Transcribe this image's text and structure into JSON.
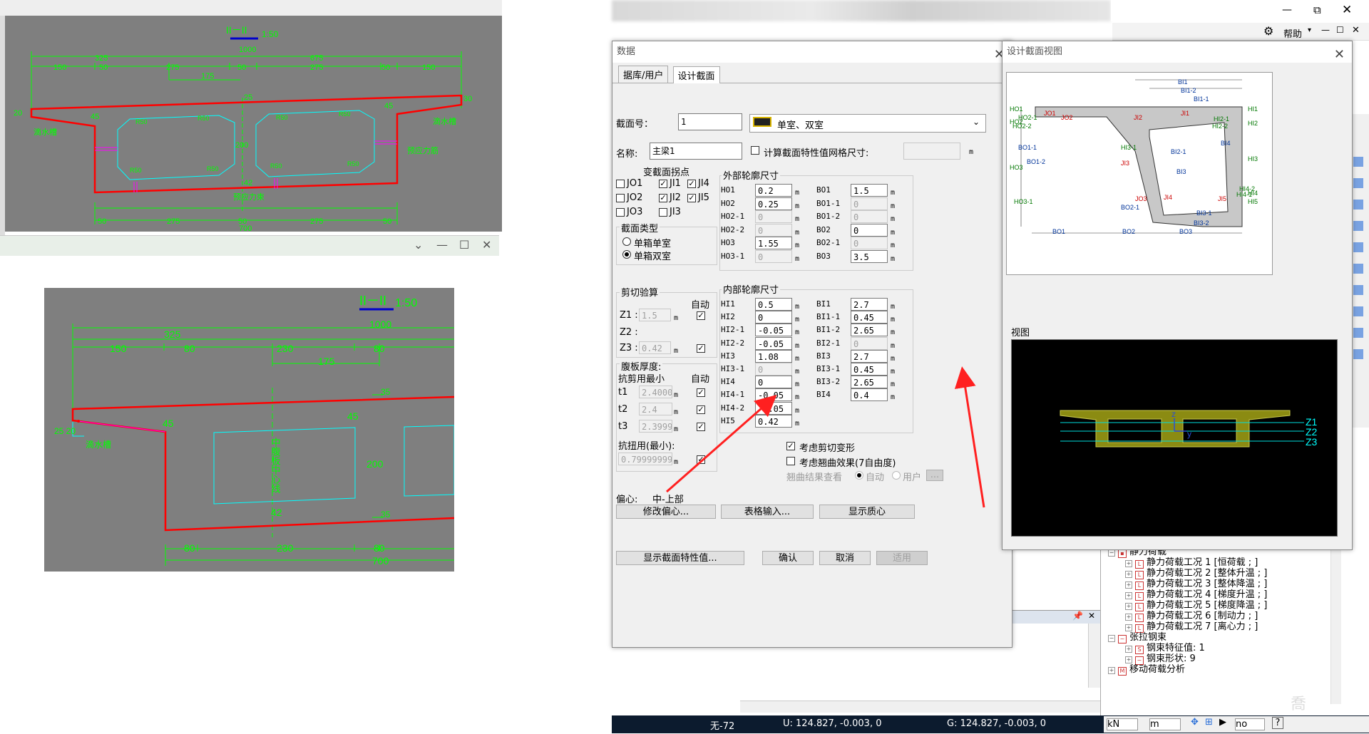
{
  "top_cad": {
    "title": "II－II",
    "scale": "1:50",
    "dims_top": [
      "325",
      "675",
      "1000"
    ],
    "dims_sub": [
      "150",
      "50",
      "275",
      "50",
      "275",
      "50",
      "150"
    ],
    "dim_175": "175",
    "dims_bottom": [
      "50",
      "275",
      "50",
      "275",
      "50",
      "700"
    ],
    "side_left": "20",
    "side_right": "30",
    "web_45_left": "45",
    "web_45_right": "45",
    "center_200": "200",
    "center_25": "25",
    "center_42": "42",
    "label_drip_left": "滴水槽",
    "label_drip_right": "滴水槽",
    "label_tendon": "预应力筋",
    "label_bottom": "预应力束",
    "ducts": [
      "R50",
      "R50",
      "R50",
      "R50",
      "R50",
      "R50",
      "R50",
      "R50"
    ]
  },
  "bottom_window": {
    "controls": [
      "⌄",
      "—",
      "☐",
      "✕"
    ]
  },
  "bottom_cad": {
    "title": "II－II",
    "scale": "1:50",
    "dim_325": "325",
    "dim_1000": "1000",
    "dims_sub": [
      "150",
      "80",
      "230",
      "80"
    ],
    "dim_175": "175",
    "left_dims": "25 20",
    "web_45_left": "45",
    "web_45_right": "45",
    "center_200": "200",
    "top_35": "35",
    "bot_35": "35",
    "center_42": "42",
    "center_text": "中腹板中心线",
    "label_drip": "滴水槽",
    "dims_bottom": [
      "80",
      "230",
      "80"
    ],
    "dim_700": "700"
  },
  "dialog": {
    "title": "数据",
    "tabs": [
      "据库/用户",
      "设计截面"
    ],
    "section_no_label": "截面号：",
    "section_no": "1",
    "section_type": "单室、双室",
    "name_label": "名称:",
    "name": "主梁1",
    "grid_calc_label": "计算截面特性值网格尺寸:",
    "grid_unit": "m",
    "joint_group": "变截面拐点",
    "joints": [
      {
        "label": "JO1",
        "checked": false
      },
      {
        "label": "JI1",
        "checked": true
      },
      {
        "label": "JI4",
        "checked": true
      },
      {
        "label": "JO2",
        "checked": false
      },
      {
        "label": "JI2",
        "checked": true
      },
      {
        "label": "JI5",
        "checked": true
      },
      {
        "label": "JO3",
        "checked": false
      },
      {
        "label": "JI3",
        "checked": false
      }
    ],
    "sec_type_group": "截面类型",
    "sec_types": [
      {
        "label": "单箱单室",
        "selected": false
      },
      {
        "label": "单箱双室",
        "selected": true
      }
    ],
    "shear_title": "剪切验算",
    "auto_label": "自动",
    "z1_label": "Z1 :",
    "z1_value": "1.5",
    "z2_label": "Z2 :",
    "z3_label": "Z3 :",
    "z3_value": "0.42",
    "web_title": "腹板厚度:",
    "web_shear_min": "抗剪用最小",
    "t1_label": "t1",
    "t1_value": "2.40000",
    "t2_label": "t2",
    "t2_value": "2.4",
    "t3_label": "t3",
    "t3_value": "2.39999",
    "torsion_label": "抗扭用(最小):",
    "torsion_value": "0.79999999",
    "unit_m": "m",
    "outer_group": "外部轮廓尺寸",
    "outer_left": [
      {
        "label": "HO1",
        "value": "0.2",
        "disabled": false
      },
      {
        "label": "HO2",
        "value": "0.25",
        "disabled": false
      },
      {
        "label": "HO2-1",
        "value": "0",
        "disabled": true
      },
      {
        "label": "HO2-2",
        "value": "0",
        "disabled": true
      },
      {
        "label": "HO3",
        "value": "1.55",
        "disabled": false
      },
      {
        "label": "HO3-1",
        "value": "0",
        "disabled": true
      }
    ],
    "outer_right": [
      {
        "label": "BO1",
        "value": "1.5",
        "disabled": false
      },
      {
        "label": "BO1-1",
        "value": "0",
        "disabled": true
      },
      {
        "label": "BO1-2",
        "value": "0",
        "disabled": true
      },
      {
        "label": "BO2",
        "value": "0",
        "disabled": false
      },
      {
        "label": "BO2-1",
        "value": "0",
        "disabled": true
      },
      {
        "label": "BO3",
        "value": "3.5",
        "disabled": false
      }
    ],
    "inner_group": "内部轮廓尺寸",
    "inner_left": [
      {
        "label": "HI1",
        "value": "0.5",
        "disabled": false
      },
      {
        "label": "HI2",
        "value": "0",
        "disabled": false
      },
      {
        "label": "HI2-1",
        "value": "-0.05",
        "disabled": false
      },
      {
        "label": "HI2-2",
        "value": "-0.05",
        "disabled": false
      },
      {
        "label": "HI3",
        "value": "1.08",
        "disabled": false
      },
      {
        "label": "HI3-1",
        "value": "0",
        "disabled": true
      },
      {
        "label": "HI4",
        "value": "0",
        "disabled": false
      },
      {
        "label": "HI4-1",
        "value": "-0.05",
        "disabled": false
      },
      {
        "label": "HI4-2",
        "value": "-0.05",
        "disabled": false
      },
      {
        "label": "HI5",
        "value": "0.42",
        "disabled": false
      }
    ],
    "inner_right": [
      {
        "label": "BI1",
        "value": "2.7",
        "disabled": false
      },
      {
        "label": "BI1-1",
        "value": "0.45",
        "disabled": false
      },
      {
        "label": "BI1-2",
        "value": "2.65",
        "disabled": false
      },
      {
        "label": "BI2-1",
        "value": "0",
        "disabled": true
      },
      {
        "label": "BI3",
        "value": "2.7",
        "disabled": false
      },
      {
        "label": "BI3-1",
        "value": "0.45",
        "disabled": false
      },
      {
        "label": "BI3-2",
        "value": "2.65",
        "disabled": false
      },
      {
        "label": "BI4",
        "value": "0.4",
        "disabled": false
      }
    ],
    "consider_shear": "考虑剪切变形",
    "consider_warp": "考虑翘曲效果(7自由度)",
    "warp_result": "翘曲结果查看",
    "warp_auto": "自动",
    "warp_user": "用户",
    "warp_btn": "...",
    "offset_label": "偏心:",
    "offset_value": "中-上部",
    "btn_modify_offset": "修改偏心...",
    "btn_table_input": "表格输入...",
    "btn_show_centroid": "显示质心",
    "btn_show_props": "显示截面特性值...",
    "btn_ok": "确认",
    "btn_cancel": "取消",
    "btn_apply": "适用"
  },
  "view_window": {
    "title": "设计截面视图",
    "diagram_labels": [
      "BI1",
      "BI1-2",
      "BI1-1",
      "HO1",
      "HO2",
      "HO2-1",
      "HO2-2",
      "JO1",
      "JO2",
      "JI2",
      "JI1",
      "HI2-1",
      "HI2-2",
      "HI1",
      "HI2",
      "HI3-1",
      "BI2-1",
      "BI4",
      "BO1-1",
      "BO1-2",
      "HO3",
      "JI3",
      "BI3",
      "HI3",
      "JI4",
      "JO3",
      "JI5",
      "HI4-2",
      "HI4-1",
      "HI4",
      "HI5",
      "HO3-1",
      "BO2-1",
      "BI3-1",
      "BI3-2",
      "BO1",
      "BO2",
      "BO3"
    ],
    "view_label": "视图",
    "axis_labels": [
      "Z1",
      "Z2",
      "Z3"
    ],
    "local_axes": [
      "z",
      "y"
    ]
  },
  "app_titlebar": {
    "help": "帮助",
    "controls": [
      "—",
      "⧉",
      "✕"
    ],
    "sub_controls": [
      "—",
      "☐",
      "✕"
    ]
  },
  "tree": {
    "root": "静力荷载",
    "items": [
      "静力荷载工况 1 [恒荷载 ; ]",
      "静力荷载工况 2 [整体升温 ; ]",
      "静力荷载工况 3 [整体降温 ; ]",
      "静力荷载工况 4 [梯度升温 ; ]",
      "静力荷载工况 5 [梯度降温 ; ]",
      "静力荷载工况 6 [制动力 ; ]",
      "静力荷载工况 7 [离心力 ; ]"
    ],
    "tendon_root": "张拉钢束",
    "tendon_items": [
      "钢束特征值: 1",
      "钢束形状: 9"
    ],
    "moving": "移动荷载分析"
  },
  "statusbar": {
    "field1": "无-72",
    "field2": "U: 124.827, -0.003, 0",
    "field3": "G: 124.827, -0.003, 0",
    "unit1": "kN",
    "unit2": "m",
    "combo": "no"
  },
  "colors": {
    "cad_bg": "#7f7f7f",
    "dim_green": "#00ff00",
    "outline_red": "#ff0000",
    "cyan": "#00ffff",
    "magenta": "#ff00ff",
    "arrow_red": "#ff2020",
    "status_bg": "#0c1b2e"
  }
}
